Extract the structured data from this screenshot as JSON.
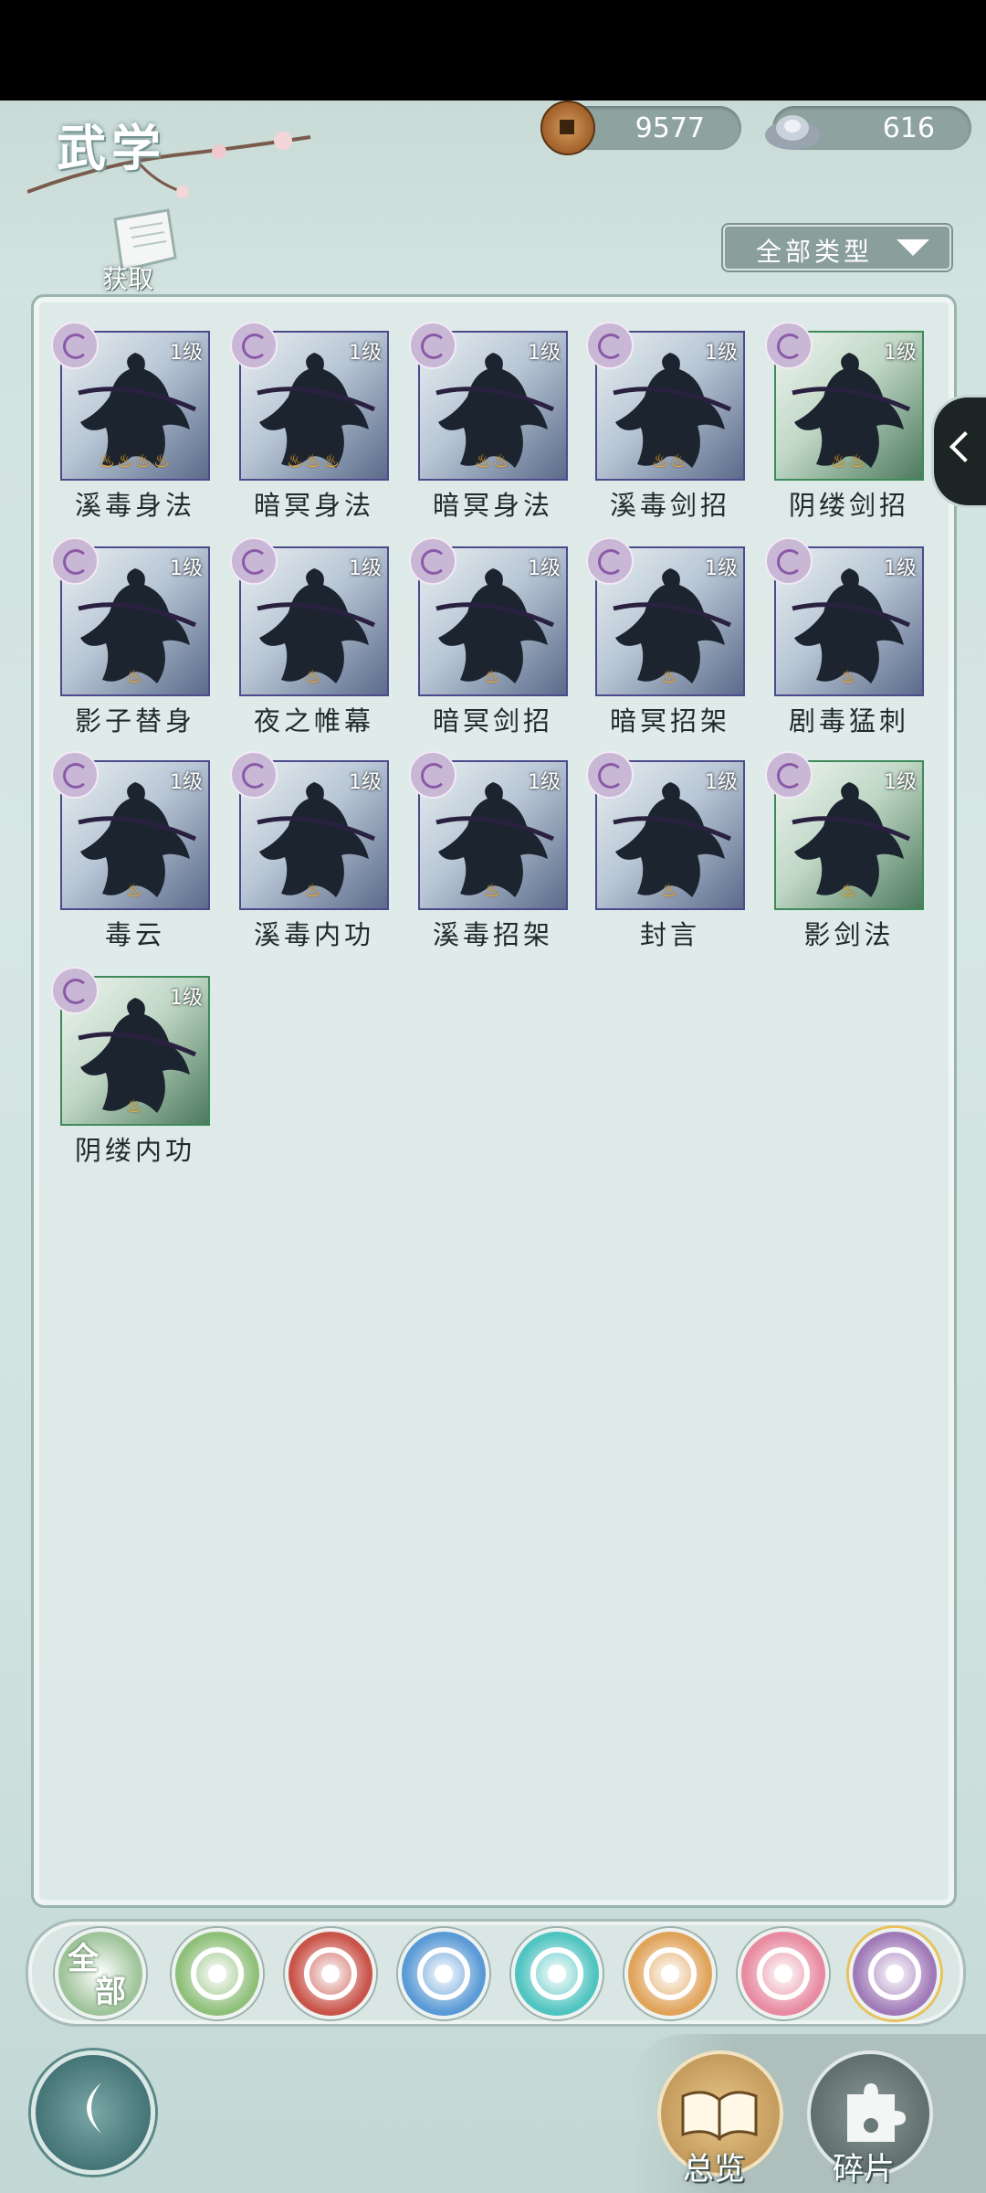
{
  "header": {
    "title": "武学",
    "copper": "9577",
    "silver": "616",
    "acquire_label": "获取",
    "filter_label": "全部类型"
  },
  "skills": [
    {
      "name": "溪毒身法",
      "level": "1级",
      "flames": 4,
      "border": "purple"
    },
    {
      "name": "暗冥身法",
      "level": "1级",
      "flames": 3,
      "border": "purple"
    },
    {
      "name": "暗冥身法",
      "level": "1级",
      "flames": 2,
      "border": "purple"
    },
    {
      "name": "溪毒剑招",
      "level": "1级",
      "flames": 2,
      "border": "purple"
    },
    {
      "name": "阴缕剑招",
      "level": "1级",
      "flames": 2,
      "border": "green"
    },
    {
      "name": "影子替身",
      "level": "1级",
      "flames": 1,
      "border": "purple"
    },
    {
      "name": "夜之帷幕",
      "level": "1级",
      "flames": 1,
      "border": "purple"
    },
    {
      "name": "暗冥剑招",
      "level": "1级",
      "flames": 1,
      "border": "purple"
    },
    {
      "name": "暗冥招架",
      "level": "1级",
      "flames": 1,
      "border": "purple"
    },
    {
      "name": "剧毒猛刺",
      "level": "1级",
      "flames": 1,
      "border": "purple"
    },
    {
      "name": "毒云",
      "level": "1级",
      "flames": 1,
      "border": "purple"
    },
    {
      "name": "溪毒内功",
      "level": "1级",
      "flames": 1,
      "border": "purple"
    },
    {
      "name": "溪毒招架",
      "level": "1级",
      "flames": 1,
      "border": "purple"
    },
    {
      "name": "封言",
      "level": "1级",
      "flames": 1,
      "border": "purple"
    },
    {
      "name": "影剑法",
      "level": "1级",
      "flames": 1,
      "border": "green"
    },
    {
      "name": "阴缕内功",
      "level": "1级",
      "flames": 1,
      "border": "green"
    }
  ],
  "tabs": {
    "all_line1": "全",
    "all_line2": "部",
    "colors": [
      "#9fc49a",
      "#8fc07a",
      "#c9544a",
      "#5a9ad6",
      "#4fc4c0",
      "#e0a35a",
      "#e88aa0",
      "#a07ab8"
    ]
  },
  "bottom": {
    "overview_label": "总览",
    "fragments_label": "碎片"
  }
}
